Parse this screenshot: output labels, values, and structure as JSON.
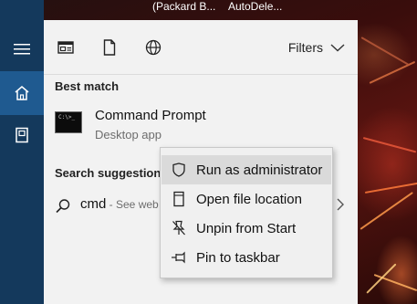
{
  "taskbar": {
    "items": [
      "(Packard B...",
      "AutoDele..."
    ]
  },
  "rail": {
    "items": [
      {
        "name": "menu",
        "icon": "hamburger-icon"
      },
      {
        "name": "home",
        "icon": "home-icon"
      },
      {
        "name": "documents",
        "icon": "document-icon"
      }
    ]
  },
  "toolbar": {
    "filters_label": "Filters",
    "icons": [
      "apps-icon",
      "documents-icon",
      "web-icon"
    ]
  },
  "results": {
    "best_match_label": "Best match",
    "best_match": {
      "title": "Command Prompt",
      "subtitle": "Desktop app",
      "icon_text": "C:\\>_"
    },
    "suggestions_label": "Search suggestions",
    "suggestion": {
      "query": "cmd",
      "suffix": " - See web"
    }
  },
  "context_menu": {
    "items": [
      {
        "label": "Run as administrator",
        "icon": "shield-icon",
        "hovered": true
      },
      {
        "label": "Open file location",
        "icon": "folder-location-icon",
        "hovered": false
      },
      {
        "label": "Unpin from Start",
        "icon": "unpin-icon",
        "hovered": false
      },
      {
        "label": "Pin to taskbar",
        "icon": "pin-icon",
        "hovered": false
      }
    ]
  },
  "colors": {
    "rail": "#14395c",
    "rail_active": "#1f5a90",
    "panel": "#f2f2f2",
    "menu_hover": "#dadada"
  }
}
